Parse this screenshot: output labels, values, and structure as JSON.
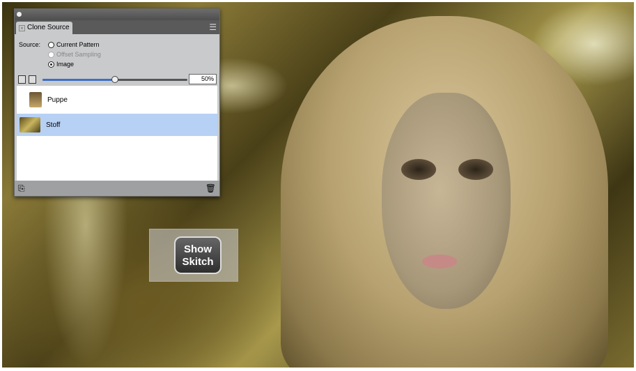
{
  "panel": {
    "tab_label": "Clone Source",
    "source_label": "Source:",
    "options": [
      {
        "label": "Current Pattern",
        "selected": false,
        "enabled": true
      },
      {
        "label": "Offset Sampling",
        "selected": false,
        "enabled": false
      },
      {
        "label": "Image",
        "selected": true,
        "enabled": true
      }
    ],
    "opacity_percent": 50,
    "opacity_text": "50%",
    "items": [
      {
        "label": "Puppe",
        "selected": false
      },
      {
        "label": "Stoff",
        "selected": true
      }
    ]
  },
  "skitch": {
    "line1": "Show",
    "line2": "Skitch"
  }
}
